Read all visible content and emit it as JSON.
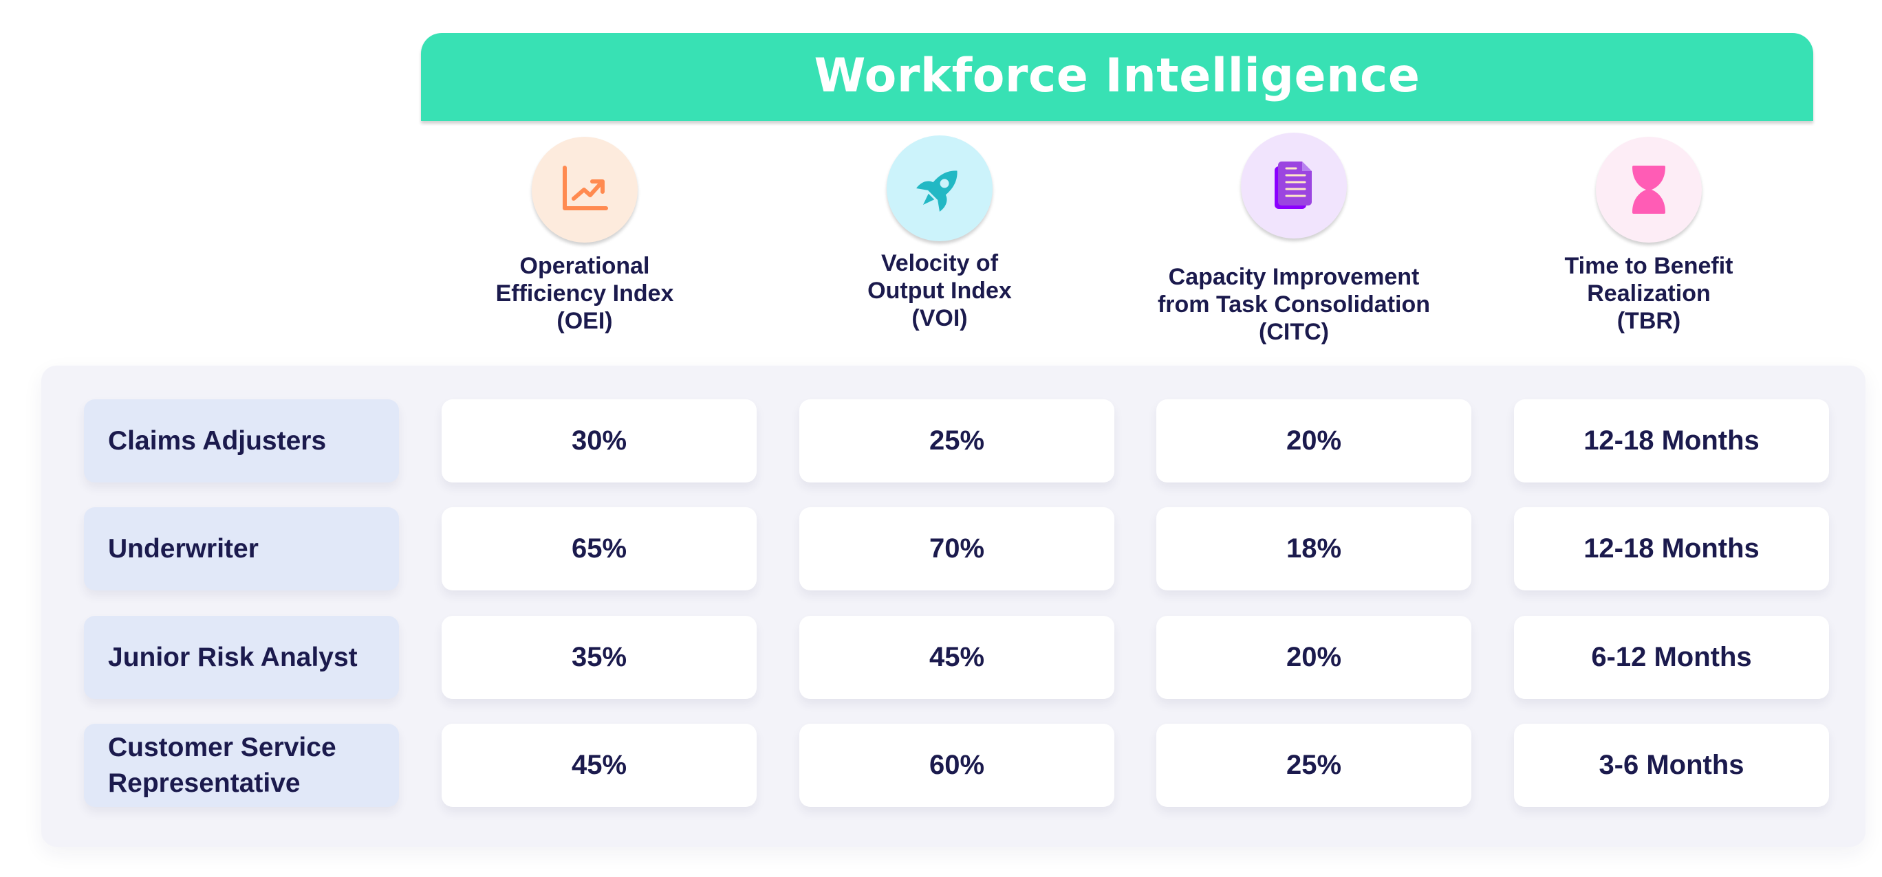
{
  "header": {
    "title": "Workforce Intelligence",
    "accent_color": "#38E1B4"
  },
  "metrics": [
    {
      "label": "Operational\nEfficiency Index\n(OEI)",
      "icon": "chart-trending-up-icon",
      "icon_color": "#FF8A50",
      "icon_bg": "#FDEBDD"
    },
    {
      "label": "Velocity of\nOutput Index\n(VOI)",
      "icon": "rocket-icon",
      "icon_color": "#22B8C4",
      "icon_bg": "#CCF3FB"
    },
    {
      "label": "Capacity Improvement\nfrom Task Consolidation\n(CITC)",
      "icon": "document-stack-icon",
      "icon_color": "#9B45E0",
      "icon_bg": "#F1E4FD"
    },
    {
      "label": "Time to Benefit\nRealization\n(TBR)",
      "icon": "hourglass-icon",
      "icon_color": "#FF5CB5",
      "icon_bg": "#FDEDF6"
    }
  ],
  "rows": [
    {
      "role": "Claims Adjusters",
      "values": [
        "30%",
        "25%",
        "20%",
        "12-18 Months"
      ]
    },
    {
      "role": "Underwriter",
      "values": [
        "65%",
        "70%",
        "18%",
        "12-18 Months"
      ]
    },
    {
      "role": "Junior Risk Analyst",
      "values": [
        "35%",
        "45%",
        "20%",
        "6-12 Months"
      ]
    },
    {
      "role": "Customer Service\nRepresentative",
      "values": [
        "45%",
        "60%",
        "25%",
        "3-6 Months"
      ]
    }
  ]
}
